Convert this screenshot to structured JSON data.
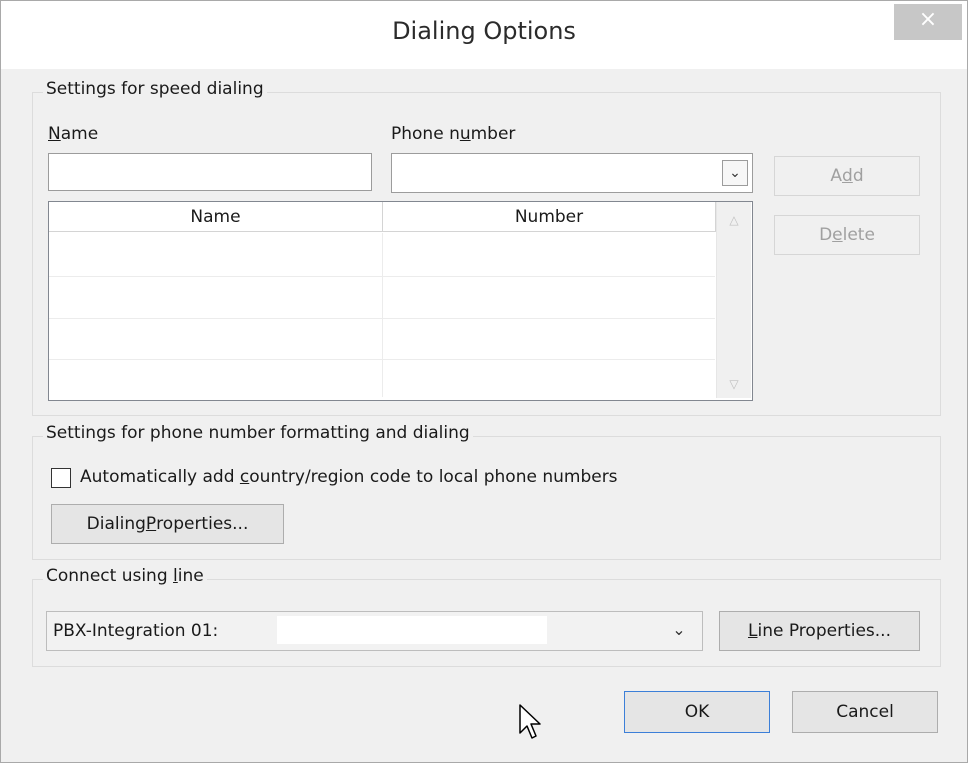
{
  "window": {
    "title": "Dialing Options",
    "close_symbol": "×"
  },
  "speed_dialing": {
    "legend": "Settings for speed dialing",
    "name_label_pre": "",
    "name_label_accel": "N",
    "name_label_post": "ame",
    "name_value": "",
    "phone_label_pre": "Phone n",
    "phone_label_accel": "u",
    "phone_label_post": "mber",
    "phone_value": "",
    "table": {
      "headers": [
        "Name",
        "Number"
      ],
      "rows": []
    },
    "add_pre": "A",
    "add_accel": "d",
    "add_post": "d",
    "delete_pre": "D",
    "delete_accel": "e",
    "delete_post": "lete"
  },
  "formatting": {
    "legend": "Settings for phone number formatting and dialing",
    "checkbox_pre": "Automatically add ",
    "checkbox_accel": "c",
    "checkbox_post": "ountry/region code to local phone numbers",
    "checkbox_checked": false,
    "dialing_props_pre": "Dialing ",
    "dialing_props_accel": "P",
    "dialing_props_post": "roperties..."
  },
  "connect": {
    "legend_pre": "Connect using ",
    "legend_accel": "l",
    "legend_post": "ine",
    "line_value": "PBX-Integration 01:",
    "line_props_pre": "",
    "line_props_accel": "L",
    "line_props_post": "ine Properties..."
  },
  "footer": {
    "ok_label": "OK",
    "cancel_label": "Cancel"
  },
  "icons": {
    "close": "close-icon",
    "dropdown": "chevron-down-icon",
    "scroll_up": "scroll-up-icon",
    "scroll_down": "scroll-down-icon",
    "cursor": "mouse-cursor-icon"
  }
}
